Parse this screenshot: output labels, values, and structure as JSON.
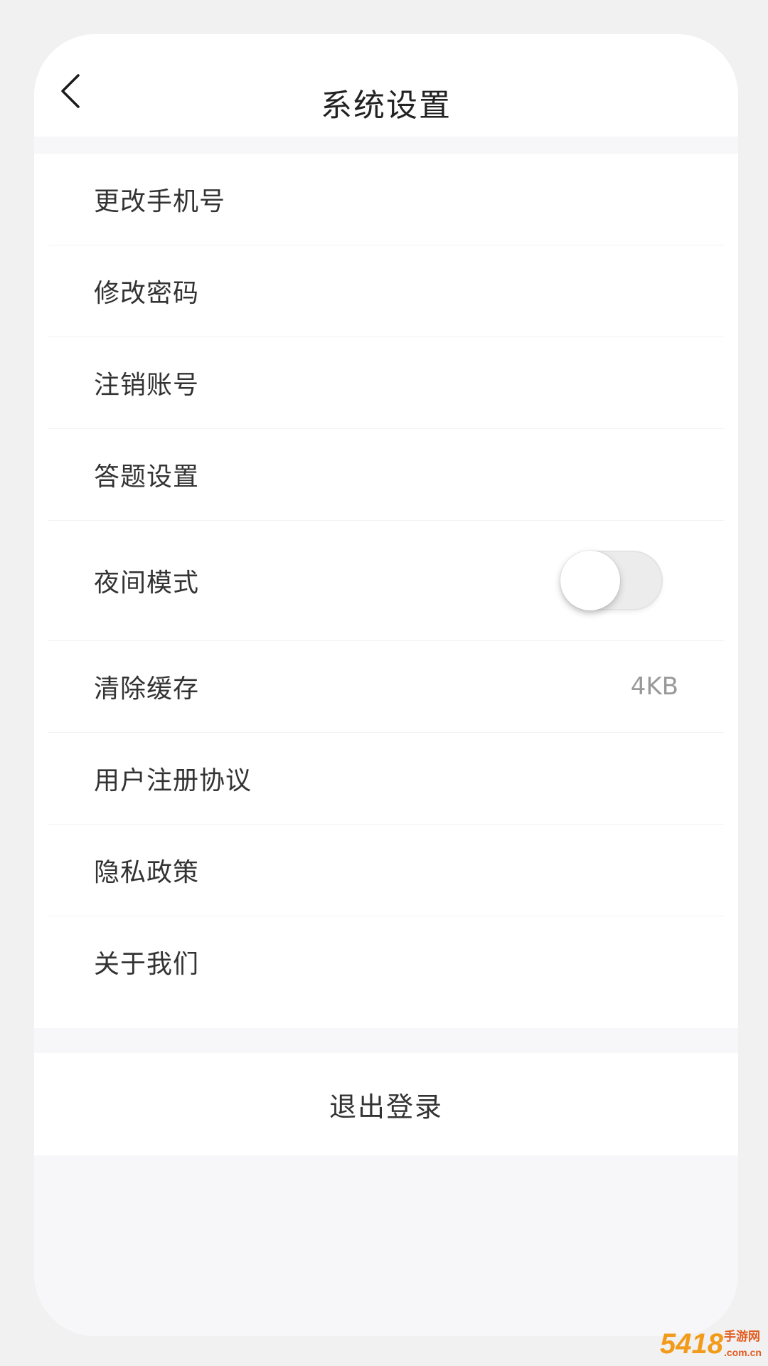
{
  "header": {
    "title": "系统设置",
    "back_icon": "chevron-left-icon"
  },
  "menu": {
    "items": [
      {
        "label": "更改手机号"
      },
      {
        "label": "修改密码"
      },
      {
        "label": "注销账号"
      },
      {
        "label": "答题设置"
      },
      {
        "label": "夜间模式",
        "toggle_on": false
      },
      {
        "label": "清除缓存",
        "value": "4KB"
      },
      {
        "label": "用户注册协议"
      },
      {
        "label": "隐私政策"
      },
      {
        "label": "关于我们"
      }
    ]
  },
  "logout": {
    "label": "退出登录"
  },
  "watermark": {
    "text": "5418手游网 .com.cn"
  },
  "colors": {
    "page_background": "#f1f1f1",
    "surface": "#ffffff",
    "text_primary": "#333333",
    "text_secondary": "#999999",
    "watermark_orange": "#f29b1a"
  }
}
